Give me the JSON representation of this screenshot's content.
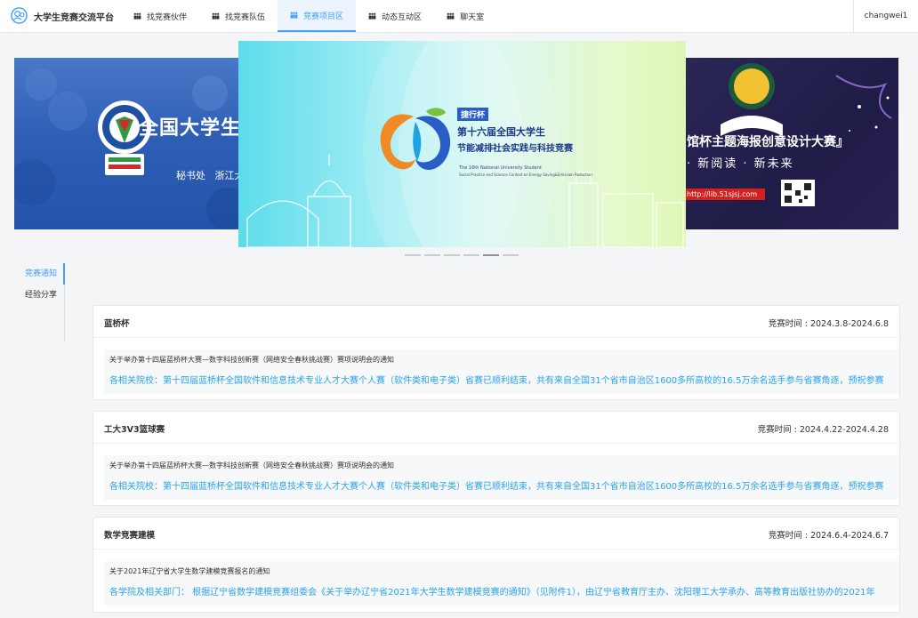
{
  "header": {
    "site_title": "大学生竞赛交流平台",
    "nav": [
      {
        "label": "找竞赛伙伴",
        "icon": "group-icon"
      },
      {
        "label": "找竞赛队伍",
        "icon": "group-icon"
      },
      {
        "label": "竞赛项目区",
        "icon": "group-icon",
        "active": true
      },
      {
        "label": "动态互动区",
        "icon": "group-icon"
      },
      {
        "label": "聊天室",
        "icon": "group-icon"
      }
    ],
    "username": "changwei1"
  },
  "carousel": {
    "left_slide": {
      "title": "全国大学生结构设计",
      "subline": "秘书处   浙江大学"
    },
    "center_slide": {
      "badge": "捷行杯",
      "title_line1": "第十六届全国大学生",
      "title_line2": "节能减排社会实践与科技竞赛",
      "en_line1": "The 16th National University Student",
      "en_line2": "Social Practice and Science Contest on Energy Saving&Emission Reduction"
    },
    "right_slide": {
      "title": "馆杯主题海报创意设计大赛』",
      "slogan": "· 新阅读 · 新未来",
      "url": "http://lib.51sjsj.com"
    },
    "indicator_count": 6,
    "active_indicator": 4
  },
  "side_menu": [
    {
      "label": "竞赛通知",
      "active": true
    },
    {
      "label": "经验分享",
      "active": false
    }
  ],
  "competitions": [
    {
      "name": "蓝桥杯",
      "time": "竞赛时间 : 2024.3.8-2024.6.8",
      "notice_title": "关于举办第十四届蓝桥杯大赛—数字科技创新赛（网络安全春秋挑战赛）赛项说明会的通知",
      "notice_body": "各相关院校：第十四届蓝桥杯全国软件和信息技术专业人才大赛个人赛（软件类和电子类）省赛已顺利结束，共有来自全国31个省市自治区1600多所高校的16.5万余名选手参与省赛角逐，预祝参赛"
    },
    {
      "name": "工大3V3篮球赛",
      "time": "竞赛时间 : 2024.4.22-2024.4.28",
      "notice_title": "关于举办第十四届蓝桥杯大赛—数字科技创新赛（网络安全春秋挑战赛）赛项说明会的通知",
      "notice_body": "各相关院校：第十四届蓝桥杯全国软件和信息技术专业人才大赛个人赛（软件类和电子类）省赛已顺利结束，共有来自全国31个省市自治区1600多所高校的16.5万余名选手参与省赛角逐，预祝参赛"
    },
    {
      "name": "数学竞赛建模",
      "time": "竞赛时间 : 2024.6.4-2024.6.7",
      "notice_title": "关于2021年辽宁省大学生数学建模竞赛报名的通知",
      "notice_body": "各学院及相关部门：  根据辽宁省数学建模竞赛组委会《关于举办辽宁省2021年大学生数学建模竞赛的通知》（见附件1），由辽宁省教育厅主办、沈阳理工大学承办、高等教育出版社协办的2021年"
    }
  ],
  "colors": {
    "accent": "#409eff",
    "notice_link": "#2aa3e8",
    "background": "#f4f5f7"
  }
}
